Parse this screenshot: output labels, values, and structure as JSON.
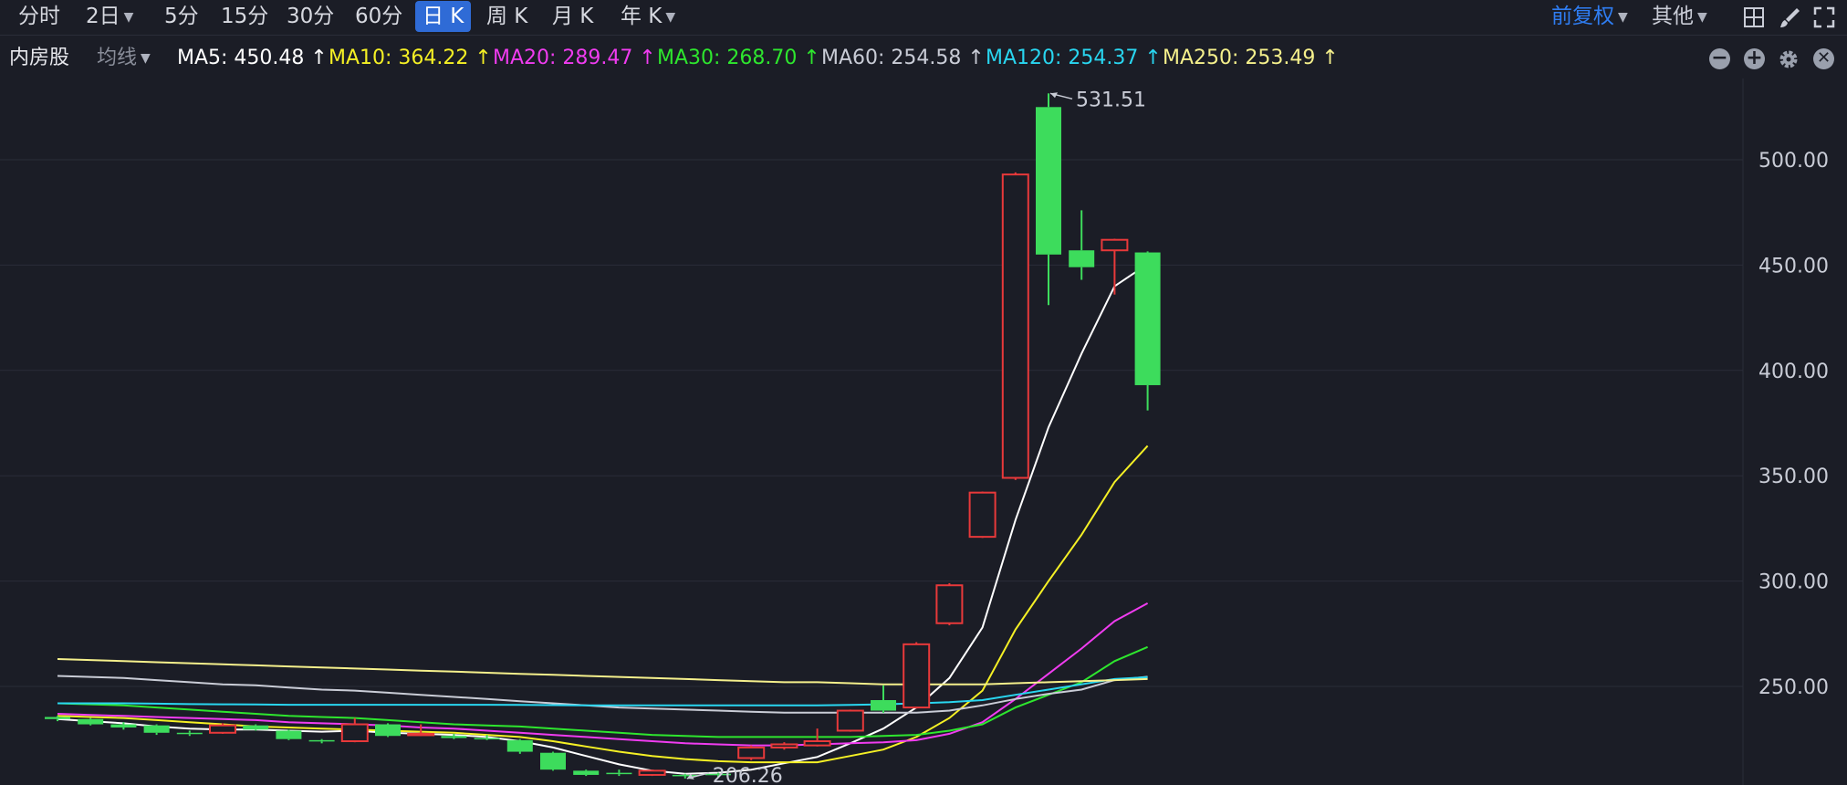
{
  "toolbar": {
    "periods": [
      "分时",
      "2日",
      "5分",
      "15分",
      "30分",
      "60分",
      "日 K",
      "周 K",
      "月 K",
      "年 K"
    ],
    "active_period": "日 K",
    "adjust": "前复权",
    "other": "其他"
  },
  "ma_bar": {
    "stock_name": "内房股",
    "avg_select": "均线",
    "items": [
      {
        "text": "MA5: 450.48 ↑",
        "color": "#ffffff"
      },
      {
        "text": "MA10: 364.22 ↑",
        "color": "#f5f025"
      },
      {
        "text": "MA20: 289.47 ↑",
        "color": "#f03cf0"
      },
      {
        "text": "MA30: 268.70 ↑",
        "color": "#2ee62e"
      },
      {
        "text": "MA60: 254.58 ↑",
        "color": "#c9ccd6"
      },
      {
        "text": "MA120: 254.37 ↑",
        "color": "#29d6f0"
      },
      {
        "text": "MA250: 253.49 ↑",
        "color": "#f5f08c"
      }
    ]
  },
  "chart_data": {
    "type": "candlestick",
    "y_ticks": [
      "500.00",
      "450.00",
      "400.00",
      "350.00",
      "300.00",
      "250.00"
    ],
    "y_tick_values": [
      500,
      450,
      400,
      350,
      300,
      250
    ],
    "ylim": [
      205,
      540
    ],
    "up_color": "#e8393a",
    "down_color": "#3ddc5c",
    "max_label": "531.51",
    "min_label": "206.26",
    "candles": [
      {
        "o": 235.5,
        "c": 234.5,
        "h": 236.0,
        "l": 233.5
      },
      {
        "o": 234.5,
        "c": 232.0,
        "h": 235.0,
        "l": 231.5
      },
      {
        "o": 232.0,
        "c": 230.5,
        "h": 233.0,
        "l": 229.5
      },
      {
        "o": 231.5,
        "c": 228.0,
        "h": 232.0,
        "l": 227.0
      },
      {
        "o": 228.0,
        "c": 227.5,
        "h": 229.0,
        "l": 226.5
      },
      {
        "o": 228.0,
        "c": 231.5,
        "h": 232.5,
        "l": 227.5
      },
      {
        "o": 231.5,
        "c": 229.5,
        "h": 232.0,
        "l": 229.0
      },
      {
        "o": 229.0,
        "c": 225.0,
        "h": 229.5,
        "l": 224.5
      },
      {
        "o": 224.5,
        "c": 224.0,
        "h": 225.0,
        "l": 223.0
      },
      {
        "o": 224.0,
        "c": 232.0,
        "h": 235.0,
        "l": 223.5
      },
      {
        "o": 232.0,
        "c": 226.5,
        "h": 232.5,
        "l": 226.0
      },
      {
        "o": 227.0,
        "c": 227.5,
        "h": 232.0,
        "l": 226.5
      },
      {
        "o": 226.5,
        "c": 225.5,
        "h": 227.5,
        "l": 225.0
      },
      {
        "o": 225.5,
        "c": 225.0,
        "h": 227.0,
        "l": 224.5
      },
      {
        "o": 224.5,
        "c": 219.0,
        "h": 225.0,
        "l": 218.0
      },
      {
        "o": 218.5,
        "c": 210.5,
        "h": 219.0,
        "l": 210.0
      },
      {
        "o": 210.0,
        "c": 208.0,
        "h": 210.5,
        "l": 207.5
      },
      {
        "o": 209.0,
        "c": 208.5,
        "h": 210.5,
        "l": 207.5
      },
      {
        "o": 208.0,
        "c": 210.0,
        "h": 210.5,
        "l": 207.5
      },
      {
        "o": 208.0,
        "c": 207.5,
        "h": 208.5,
        "l": 206.3
      },
      {
        "o": 208.5,
        "c": 208.0,
        "h": 209.0,
        "l": 207.0
      },
      {
        "o": 216.0,
        "c": 221.0,
        "h": 222.0,
        "l": 215.0
      },
      {
        "o": 221.0,
        "c": 222.5,
        "h": 223.5,
        "l": 220.0
      },
      {
        "o": 222.0,
        "c": 224.0,
        "h": 230.0,
        "l": 221.5
      },
      {
        "o": 229.0,
        "c": 238.5,
        "h": 239.0,
        "l": 228.5
      },
      {
        "o": 243.5,
        "c": 238.5,
        "h": 250.5,
        "l": 237.5
      },
      {
        "o": 240.0,
        "c": 270.0,
        "h": 271.0,
        "l": 239.5
      },
      {
        "o": 280.0,
        "c": 298.0,
        "h": 299.0,
        "l": 279.0
      },
      {
        "o": 321.0,
        "c": 342.0,
        "h": 342.5,
        "l": 320.5
      },
      {
        "o": 349.0,
        "c": 493.0,
        "h": 494.0,
        "l": 348.0
      },
      {
        "o": 525.0,
        "c": 455.0,
        "h": 531.5,
        "l": 431.0
      },
      {
        "o": 457.0,
        "c": 449.0,
        "h": 476.0,
        "l": 443.0
      },
      {
        "o": 457.0,
        "c": 462.0,
        "h": 462.5,
        "l": 436.0
      },
      {
        "o": 456.0,
        "c": 393.0,
        "h": 456.5,
        "l": 381.0
      }
    ],
    "series": [
      {
        "name": "MA5",
        "color": "#ffffff",
        "values": [
          234.5,
          233.5,
          232.5,
          231.0,
          230.0,
          229.5,
          229.5,
          229.0,
          228.5,
          229.0,
          228.0,
          227.5,
          227.0,
          226.0,
          224.0,
          221.0,
          217.0,
          213.0,
          210.0,
          208.5,
          209.0,
          210.5,
          213.5,
          216.5,
          223.0,
          230.0,
          240.0,
          254.0,
          278.0,
          329.0,
          373.0,
          408.0,
          440.0,
          450.48
        ]
      },
      {
        "name": "MA10",
        "color": "#f5f025",
        "values": [
          236.0,
          235.5,
          235.0,
          234.0,
          233.0,
          232.0,
          231.0,
          230.5,
          230.0,
          229.5,
          229.0,
          228.5,
          228.0,
          227.0,
          226.0,
          224.0,
          221.5,
          219.0,
          217.0,
          215.5,
          214.5,
          214.0,
          214.0,
          214.0,
          217.0,
          220.0,
          226.0,
          235.0,
          248.0,
          277.0,
          300.0,
          322.0,
          347.0,
          364.22
        ]
      },
      {
        "name": "MA20",
        "color": "#f03cf0",
        "values": [
          237.0,
          236.5,
          236.0,
          235.5,
          235.0,
          234.5,
          234.0,
          233.0,
          232.5,
          232.0,
          231.5,
          230.5,
          230.0,
          229.0,
          228.0,
          227.0,
          226.0,
          225.0,
          224.0,
          223.0,
          222.5,
          222.0,
          222.0,
          222.5,
          223.0,
          223.5,
          224.5,
          227.5,
          233.0,
          244.0,
          256.0,
          268.0,
          281.0,
          289.47
        ]
      },
      {
        "name": "MA30",
        "color": "#2ee62e",
        "values": [
          242.0,
          241.5,
          241.0,
          240.0,
          239.0,
          238.0,
          237.0,
          236.0,
          235.5,
          235.0,
          234.0,
          233.0,
          232.0,
          231.5,
          231.0,
          230.0,
          229.0,
          228.0,
          227.0,
          226.5,
          226.0,
          226.0,
          226.0,
          226.0,
          226.0,
          226.5,
          227.0,
          229.0,
          232.0,
          240.0,
          246.0,
          252.0,
          262.0,
          268.7
        ]
      },
      {
        "name": "MA60",
        "color": "#c9ccd6",
        "values": [
          255.0,
          254.5,
          254.0,
          253.0,
          252.0,
          251.0,
          250.5,
          249.5,
          248.5,
          248.0,
          247.0,
          246.0,
          245.0,
          244.0,
          243.0,
          242.0,
          241.0,
          240.0,
          239.5,
          239.0,
          238.5,
          238.0,
          237.5,
          237.5,
          237.5,
          237.5,
          237.5,
          238.5,
          241.0,
          244.0,
          246.5,
          248.5,
          253.0,
          254.58
        ]
      },
      {
        "name": "MA120",
        "color": "#29d6f0",
        "values": [
          242.0,
          242.0,
          242.0,
          241.8,
          241.6,
          241.5,
          241.4,
          241.3,
          241.3,
          241.3,
          241.3,
          241.3,
          241.3,
          241.3,
          241.2,
          241.1,
          241.0,
          241.0,
          241.0,
          241.0,
          241.0,
          241.0,
          241.0,
          241.0,
          241.2,
          241.5,
          242.0,
          242.5,
          243.5,
          246.0,
          248.5,
          251.0,
          253.5,
          254.37
        ]
      },
      {
        "name": "MA250",
        "color": "#f5f08c",
        "values": [
          263.0,
          262.5,
          262.0,
          261.5,
          261.0,
          260.5,
          260.0,
          259.5,
          259.0,
          258.5,
          258.0,
          257.5,
          257.0,
          256.5,
          256.0,
          255.5,
          255.0,
          254.5,
          254.0,
          253.5,
          253.0,
          252.5,
          252.0,
          252.0,
          251.5,
          251.0,
          251.0,
          251.0,
          251.0,
          251.5,
          252.0,
          252.5,
          253.0,
          253.49
        ]
      }
    ]
  }
}
